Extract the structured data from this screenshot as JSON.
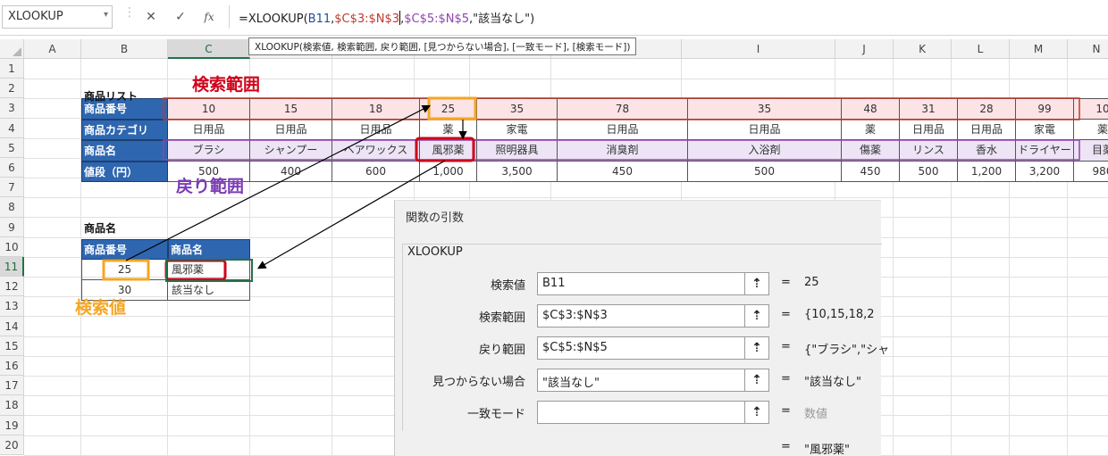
{
  "formula_bar": {
    "name_box": "XLOOKUP",
    "dropdown_glyph": "▾",
    "cancel_glyph": "✕",
    "confirm_glyph": "✓",
    "fx_label": "fx",
    "formula_prefix": "=XLOOKUP(",
    "arg1": "B11",
    "arg2": "$C$3:$N$3",
    "arg3": "$C$5:$N$5",
    "formula_suffix": ",\"該当なし\")"
  },
  "tooltip": "XLOOKUP(検索値, 検索範囲, 戻り範囲, [見つからない場合], [一致モード], [検索モード])",
  "columns": [
    "A",
    "B",
    "C",
    "D",
    "E",
    "F",
    "G",
    "H",
    "I",
    "J",
    "K",
    "L",
    "M",
    "N",
    "O"
  ],
  "rows": [
    "1",
    "2",
    "3",
    "4",
    "5",
    "6",
    "7",
    "8",
    "9",
    "10",
    "11",
    "12",
    "13",
    "14",
    "15",
    "16",
    "17",
    "18",
    "19",
    "20"
  ],
  "table": {
    "title": "商品リスト",
    "row_labels": [
      "商品番号",
      "商品カテゴリ",
      "商品名",
      "値段（円）"
    ],
    "ids": [
      "10",
      "15",
      "18",
      "25",
      "35",
      "78",
      "35",
      "48",
      "31",
      "28",
      "99",
      "10"
    ],
    "categories": [
      "日用品",
      "日用品",
      "日用品",
      "薬",
      "家電",
      "日用品",
      "日用品",
      "薬",
      "日用品",
      "日用品",
      "家電",
      "薬"
    ],
    "names": [
      "ブラシ",
      "シャンプー",
      "ヘアワックス",
      "風邪薬",
      "照明器具",
      "消臭剤",
      "入浴剤",
      "傷薬",
      "リンス",
      "香水",
      "ドライヤー",
      "目薬"
    ],
    "prices": [
      "500",
      "400",
      "600",
      "1,000",
      "3,500",
      "450",
      "500",
      "450",
      "500",
      "1,200",
      "3,200",
      "980"
    ]
  },
  "lookup": {
    "title": "商品名",
    "col1": "商品番号",
    "col2": "商品名",
    "r1_id": "25",
    "r1_name": "風邪薬",
    "r2_id": "30",
    "r2_name": "該当なし"
  },
  "annotations": {
    "search_range": "検索範囲",
    "return_range": "戻り範囲",
    "search_value": "検索値"
  },
  "colors": {
    "search_range": "#d0021b",
    "return_range": "#7d3cb5",
    "search_value": "#f5a623",
    "header_blue": "#2e66b0"
  },
  "dialog": {
    "title": "関数の引数",
    "function": "XLOOKUP",
    "args": [
      {
        "label": "検索値",
        "value": "B11",
        "result": "25"
      },
      {
        "label": "検索範囲",
        "value": "$C$3:$N$3",
        "result": "{10,15,18,2"
      },
      {
        "label": "戻り範囲",
        "value": "$C$5:$N$5",
        "result": "{\"ブラシ\",\"シャ"
      },
      {
        "label": "見つからない場合",
        "value": "\"該当なし\"",
        "result": "\"該当なし\""
      },
      {
        "label": "一致モード",
        "value": "",
        "result": "数値"
      }
    ],
    "ref_button": "⇡",
    "eq": "=",
    "final_result": "\"風邪薬\""
  }
}
